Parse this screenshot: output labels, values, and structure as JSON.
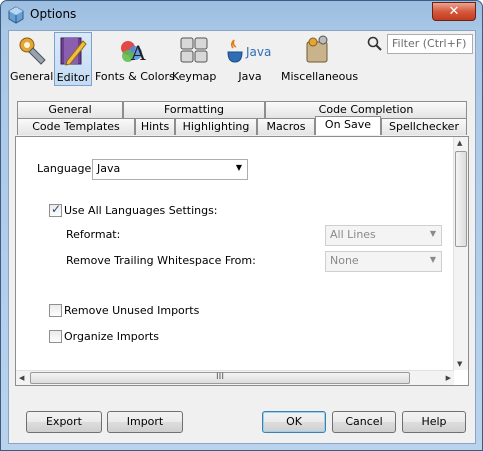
{
  "window": {
    "title": "Options",
    "close_glyph": "✕"
  },
  "categories": [
    {
      "label": "General",
      "icon": "general-gear-icon"
    },
    {
      "label": "Editor",
      "icon": "editor-pencil-icon",
      "selected": true
    },
    {
      "label": "Fonts & Colors",
      "icon": "fonts-colors-icon"
    },
    {
      "label": "Keymap",
      "icon": "keymap-keyboard-icon"
    },
    {
      "label": "Java",
      "icon": "java-cup-icon",
      "icon_text": "Java"
    },
    {
      "label": "Miscellaneous",
      "icon": "miscellaneous-icon"
    }
  ],
  "filter": {
    "placeholder": "Filter (Ctrl+F)"
  },
  "tabs": {
    "row1": [
      "General",
      "Formatting",
      "Code Completion"
    ],
    "row2": [
      "Code Templates",
      "Hints",
      "Highlighting",
      "Macros",
      "On Save",
      "Spellchecker"
    ],
    "active": "On Save"
  },
  "form": {
    "language_label": "Language:",
    "language_value": "Java",
    "use_all_label": "Use All Languages Settings:",
    "use_all_checked": true,
    "reformat_label": "Reformat:",
    "reformat_value": "All Lines",
    "whitespace_label": "Remove Trailing Whitespace From:",
    "whitespace_value": "None",
    "remove_unused_label": "Remove Unused Imports",
    "remove_unused_checked": false,
    "organize_label": "Organize Imports",
    "organize_checked": false
  },
  "buttons": {
    "export": "Export",
    "import": "Import",
    "ok": "OK",
    "cancel": "Cancel",
    "help": "Help"
  },
  "glyphs": {
    "check": "✓",
    "dropdown": "▼",
    "up": "▲",
    "down": "▼",
    "left": "◀",
    "right": "▶",
    "grip": "III"
  }
}
